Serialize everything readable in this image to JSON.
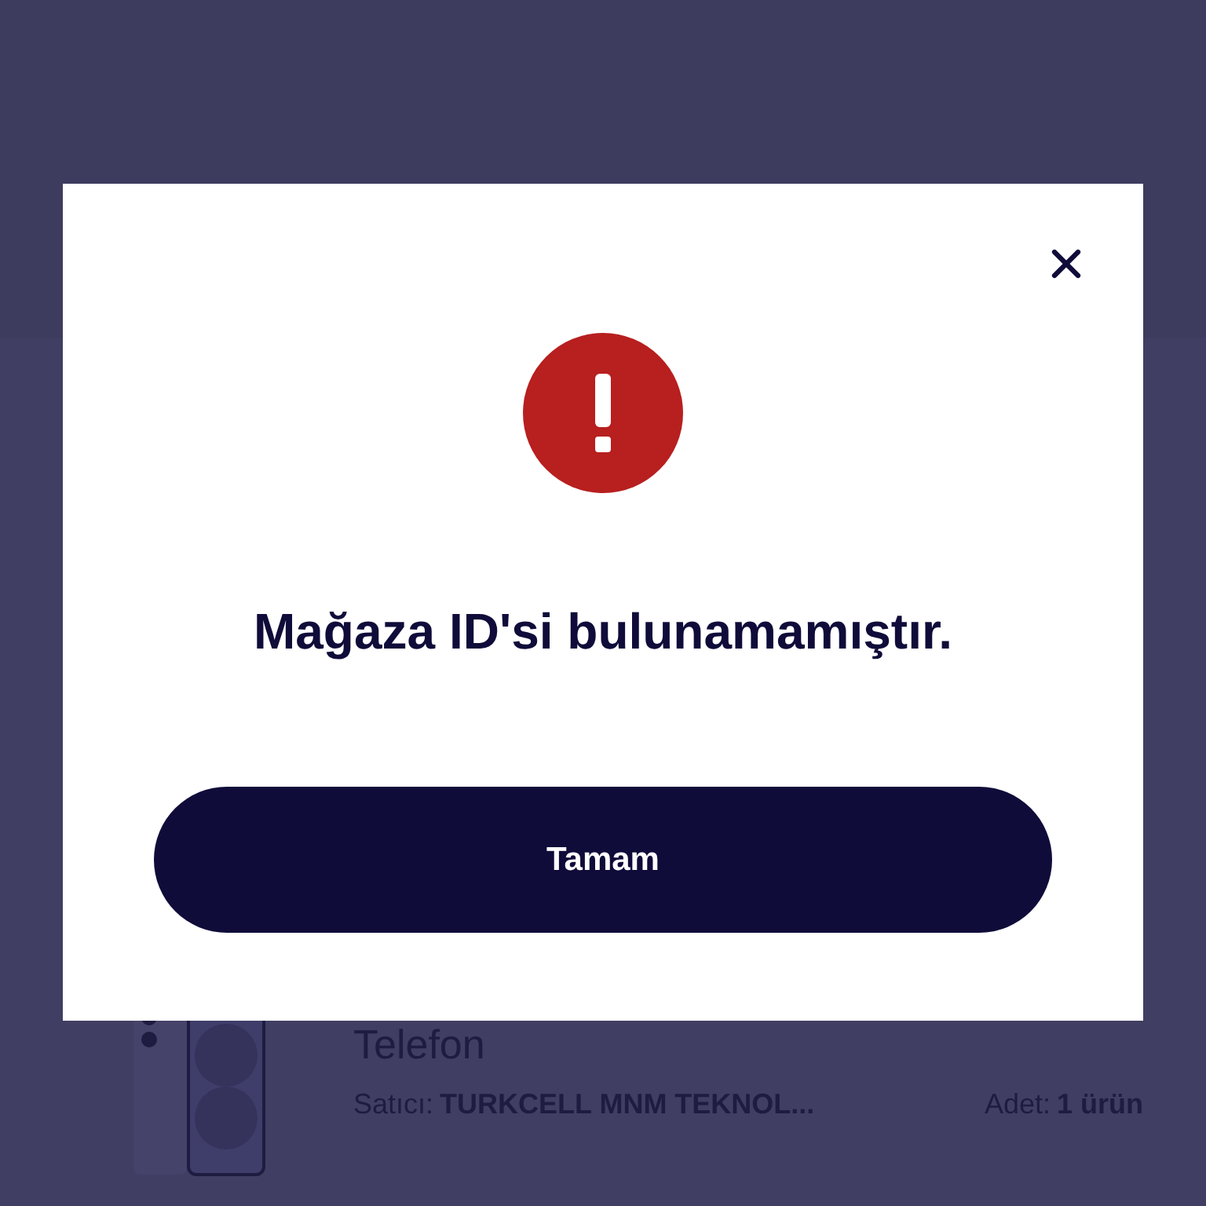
{
  "product": {
    "name": "Telefon",
    "seller_label": "Satıcı:",
    "seller": "TURKCELL MNM TEKNOL...",
    "quantity_label": "Adet:",
    "quantity": "1 ürün"
  },
  "dialog": {
    "kind": "error",
    "message": "Mağaza ID'si bulunamamıştır.",
    "button": "Tamam"
  }
}
